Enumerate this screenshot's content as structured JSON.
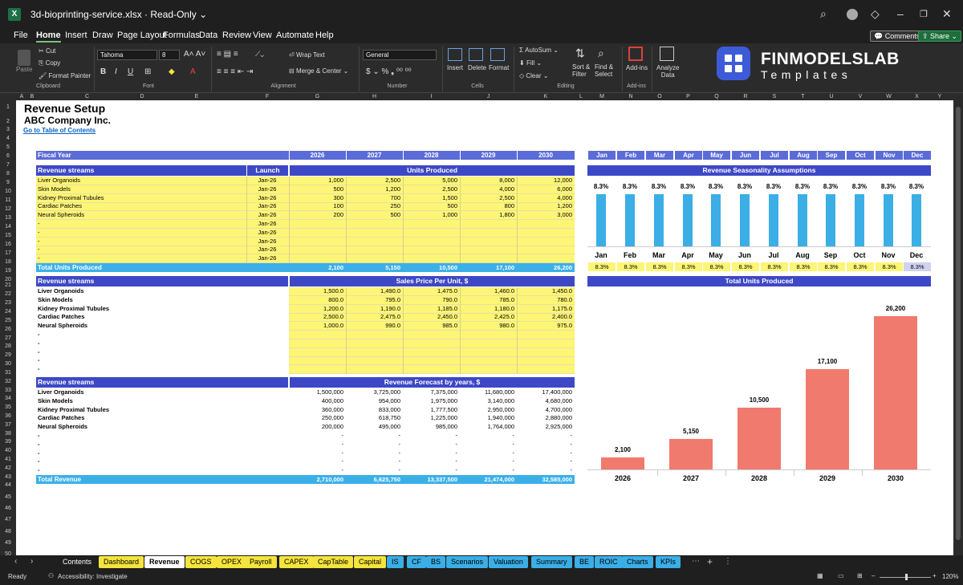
{
  "window": {
    "logo": "X",
    "file_title": "3d-bioprinting-service.xlsx  ·  Read-Only ⌄"
  },
  "menu": [
    "File",
    "Home",
    "Insert",
    "Draw",
    "Page Layout",
    "Formulas",
    "Data",
    "Review",
    "View",
    "Automate",
    "Help"
  ],
  "top_buttons": {
    "comments": "💬 Comments",
    "share": "⇪ Share ⌄"
  },
  "ribbon": {
    "clipboard": {
      "paste": "Paste",
      "cut": "Cut",
      "copy": "Copy",
      "format_painter": "Format Painter",
      "label": "Clipboard"
    },
    "font": {
      "family": "Tahoma",
      "size": "8",
      "label": "Font"
    },
    "alignment": {
      "wrap": "Wrap Text",
      "merge": "Merge & Center",
      "label": "Alignment"
    },
    "number": {
      "format": "General",
      "label": "Number"
    },
    "cells": {
      "insert": "Insert",
      "delete": "Delete",
      "format": "Format",
      "label": "Cells"
    },
    "editing": {
      "autosum": "AutoSum",
      "fill": "Fill",
      "clear": "Clear",
      "sort": "Sort &",
      "sort2": "Filter",
      "find": "Find &",
      "find2": "Select",
      "label": "Editing"
    },
    "addins": {
      "addins": "Add-ins",
      "label": "Add-ins"
    },
    "analyze": {
      "line1": "Analyze",
      "line2": "Data"
    }
  },
  "brand": {
    "name": "FINMODELSLAB",
    "sub": "Templates"
  },
  "columns": [
    "A",
    "B",
    "C",
    "D",
    "E",
    "F",
    "G",
    "H",
    "I",
    "J",
    "K",
    "L",
    "M",
    "N",
    "O",
    "P",
    "Q",
    "R",
    "S",
    "T",
    "U",
    "V",
    "W",
    "X",
    "Y"
  ],
  "rows": [
    "1",
    "2",
    "3",
    "4",
    "5",
    "6",
    "7",
    "8",
    "9",
    "10",
    "11",
    "12",
    "13",
    "14",
    "15",
    "16",
    "17",
    "18",
    "19",
    "20",
    "21",
    "22",
    "23",
    "24",
    "25",
    "26",
    "27",
    "28",
    "29",
    "30",
    "31",
    "32",
    "33",
    "34",
    "35",
    "36",
    "37",
    "38",
    "39",
    "40",
    "41",
    "42",
    "43",
    "44",
    "45",
    "46",
    "47",
    "48",
    "49",
    "50"
  ],
  "sheet": {
    "title": "Revenue Setup",
    "company": "ABC Company Inc.",
    "toc_link": "Go to Table of Contents",
    "fiscal_year_label": "Fiscal Year",
    "years": [
      "2026",
      "2027",
      "2028",
      "2029",
      "2030"
    ],
    "months": [
      "Jan",
      "Feb",
      "Mar",
      "Apr",
      "May",
      "Jun",
      "Jul",
      "Aug",
      "Sep",
      "Oct",
      "Nov",
      "Dec"
    ],
    "streams_label": "Revenue streams",
    "launch_label": "Launch",
    "units_label": "Units Produced",
    "units_rows": [
      {
        "name": "Liver Organoids",
        "launch": "Jan-26",
        "v": [
          "1,000",
          "2,500",
          "5,000",
          "8,000",
          "12,000"
        ]
      },
      {
        "name": "Skin Models",
        "launch": "Jan-26",
        "v": [
          "500",
          "1,200",
          "2,500",
          "4,000",
          "6,000"
        ]
      },
      {
        "name": "Kidney Proximal Tubules",
        "launch": "Jan-26",
        "v": [
          "300",
          "700",
          "1,500",
          "2,500",
          "4,000"
        ]
      },
      {
        "name": "Cardiac Patches",
        "launch": "Jan-26",
        "v": [
          "100",
          "250",
          "500",
          "800",
          "1,200"
        ]
      },
      {
        "name": "Neural Spheroids",
        "launch": "Jan-26",
        "v": [
          "200",
          "500",
          "1,000",
          "1,800",
          "3,000"
        ]
      },
      {
        "name": "-",
        "launch": "Jan-26",
        "v": [
          "",
          "",
          "",
          "",
          ""
        ]
      },
      {
        "name": "-",
        "launch": "Jan-26",
        "v": [
          "",
          "",
          "",
          "",
          ""
        ]
      },
      {
        "name": "-",
        "launch": "Jan-26",
        "v": [
          "",
          "",
          "",
          "",
          ""
        ]
      },
      {
        "name": "-",
        "launch": "Jan-26",
        "v": [
          "",
          "",
          "",
          "",
          ""
        ]
      },
      {
        "name": "-",
        "launch": "Jan-26",
        "v": [
          "",
          "",
          "",
          "",
          ""
        ]
      }
    ],
    "total_units_label": "Total Units Produced",
    "total_units": [
      "2,100",
      "5,150",
      "10,500",
      "17,100",
      "26,200"
    ],
    "price_label": "Sales Price Per Unit, $",
    "price_rows": [
      {
        "name": "Liver Organoids",
        "v": [
          "1,500.0",
          "1,490.0",
          "1,475.0",
          "1,460.0",
          "1,450.0"
        ]
      },
      {
        "name": "Skin Models",
        "v": [
          "800.0",
          "795.0",
          "790.0",
          "785.0",
          "780.0"
        ]
      },
      {
        "name": "Kidney Proximal Tubules",
        "v": [
          "1,200.0",
          "1,190.0",
          "1,185.0",
          "1,180.0",
          "1,175.0"
        ]
      },
      {
        "name": "Cardiac Patches",
        "v": [
          "2,500.0",
          "2,475.0",
          "2,450.0",
          "2,425.0",
          "2,400.0"
        ]
      },
      {
        "name": "Neural Spheroids",
        "v": [
          "1,000.0",
          "990.0",
          "985.0",
          "980.0",
          "975.0"
        ]
      },
      {
        "name": "-",
        "v": [
          "",
          "",
          "",
          "",
          ""
        ]
      },
      {
        "name": "-",
        "v": [
          "",
          "",
          "",
          "",
          ""
        ]
      },
      {
        "name": "-",
        "v": [
          "",
          "",
          "",
          "",
          ""
        ]
      },
      {
        "name": "-",
        "v": [
          "",
          "",
          "",
          "",
          ""
        ]
      },
      {
        "name": "-",
        "v": [
          "",
          "",
          "",
          "",
          ""
        ]
      }
    ],
    "forecast_label": "Revenue Forecast by years, $",
    "forecast_rows": [
      {
        "name": "Liver Organoids",
        "v": [
          "1,500,000",
          "3,725,000",
          "7,375,000",
          "11,680,000",
          "17,400,000"
        ]
      },
      {
        "name": "Skin Models",
        "v": [
          "400,000",
          "954,000",
          "1,975,000",
          "3,140,000",
          "4,680,000"
        ]
      },
      {
        "name": "Kidney Proximal Tubules",
        "v": [
          "360,000",
          "833,000",
          "1,777,500",
          "2,950,000",
          "4,700,000"
        ]
      },
      {
        "name": "Cardiac Patches",
        "v": [
          "250,000",
          "618,750",
          "1,225,000",
          "1,940,000",
          "2,880,000"
        ]
      },
      {
        "name": "Neural Spheroids",
        "v": [
          "200,000",
          "495,000",
          "985,000",
          "1,764,000",
          "2,925,000"
        ]
      },
      {
        "name": "-",
        "v": [
          "-",
          "-",
          "-",
          "-",
          "-"
        ]
      },
      {
        "name": "-",
        "v": [
          "-",
          "-",
          "-",
          "-",
          "-"
        ]
      },
      {
        "name": "-",
        "v": [
          "-",
          "-",
          "-",
          "-",
          "-"
        ]
      },
      {
        "name": "-",
        "v": [
          "-",
          "-",
          "-",
          "-",
          "-"
        ]
      },
      {
        "name": "-",
        "v": [
          "-",
          "-",
          "-",
          "-",
          "-"
        ]
      }
    ],
    "total_revenue_label": "Total Revenue",
    "total_revenue": [
      "2,710,000",
      "6,625,750",
      "13,337,500",
      "21,474,000",
      "32,585,000"
    ],
    "seasonality_title": "Revenue Seasonality Assumptions",
    "seasonality_row": [
      "8.3%",
      "8.3%",
      "8.3%",
      "8.3%",
      "8.3%",
      "8.3%",
      "8.3%",
      "8.3%",
      "8.3%",
      "8.3%",
      "8.3%",
      "8.3%"
    ],
    "total_units_chart_title": "Total Units Produced"
  },
  "chart_data": [
    {
      "type": "bar",
      "title": "Revenue Seasonality Assumptions",
      "categories": [
        "Jan",
        "Feb",
        "Mar",
        "Apr",
        "May",
        "Jun",
        "Jul",
        "Aug",
        "Sep",
        "Oct",
        "Nov",
        "Dec"
      ],
      "values": [
        8.3,
        8.3,
        8.3,
        8.3,
        8.3,
        8.3,
        8.3,
        8.3,
        8.3,
        8.3,
        8.3,
        8.3
      ],
      "labels": [
        "8.3%",
        "8.3%",
        "8.3%",
        "8.3%",
        "8.3%",
        "8.3%",
        "8.3%",
        "8.3%",
        "8.3%",
        "8.3%",
        "8.3%",
        "8.3%"
      ],
      "color": "#3baee6"
    },
    {
      "type": "bar",
      "title": "Total Units Produced",
      "categories": [
        "2026",
        "2027",
        "2028",
        "2029",
        "2030"
      ],
      "values": [
        2100,
        5150,
        10500,
        17100,
        26200
      ],
      "labels": [
        "2,100",
        "5,150",
        "10,500",
        "17,100",
        "26,200"
      ],
      "color": "#f07a6d"
    }
  ],
  "tabs": [
    {
      "label": "Contents",
      "style": "c"
    },
    {
      "label": "Dashboard",
      "style": "y"
    },
    {
      "label": "Revenue",
      "style": "w"
    },
    {
      "label": "COGS",
      "style": "y"
    },
    {
      "label": "OPEX",
      "style": "y"
    },
    {
      "label": "Payroll",
      "style": "y"
    },
    {
      "label": "CAPEX",
      "style": "y"
    },
    {
      "label": "CapTable",
      "style": "y"
    },
    {
      "label": "Capital",
      "style": "y"
    },
    {
      "label": "IS",
      "style": "b"
    },
    {
      "label": "CF",
      "style": "b"
    },
    {
      "label": "BS",
      "style": "b"
    },
    {
      "label": "Scenarios",
      "style": "b"
    },
    {
      "label": "Valuation",
      "style": "b"
    },
    {
      "label": "Summary",
      "style": "b"
    },
    {
      "label": "BE",
      "style": "b"
    },
    {
      "label": "ROIC",
      "style": "b"
    },
    {
      "label": "Charts",
      "style": "b"
    },
    {
      "label": "KPIs",
      "style": "b"
    }
  ],
  "status": {
    "ready": "Ready",
    "accessibility": "Accessibility: Investigate",
    "zoom": "120%"
  },
  "colors": {
    "header": "#5b6bd8",
    "header_dark": "#3d48c6",
    "input": "#fdf576",
    "total": "#3bb0e8",
    "bar_blue": "#3baee6",
    "bar_red": "#f07a6d"
  }
}
